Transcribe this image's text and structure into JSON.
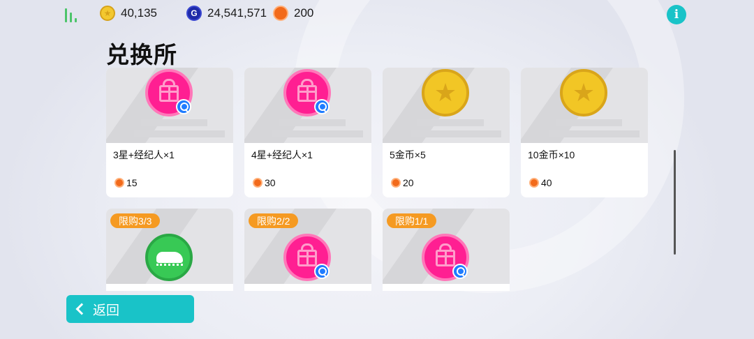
{
  "currencies": {
    "gold": "40,135",
    "gp": "24,541,571",
    "gp_icon_letter": "G",
    "tokens": "200"
  },
  "page_title": "兑换所",
  "items_row1": [
    {
      "name": "3星+经纪人×1",
      "price": "15",
      "icon": "gift-icon"
    },
    {
      "name": "4星+经纪人×1",
      "price": "30",
      "icon": "gift-icon"
    },
    {
      "name": "5金币×5",
      "price": "20",
      "icon": "star-coin-icon"
    },
    {
      "name": "10金币×10",
      "price": "40",
      "icon": "star-coin-icon"
    }
  ],
  "items_row2": [
    {
      "limit": "限购3/3",
      "icon": "boot-icon"
    },
    {
      "limit": "限购2/2",
      "icon": "gift-icon"
    },
    {
      "limit": "限购1/1",
      "icon": "gift-icon"
    }
  ],
  "back_label": "返回",
  "info_label": "i",
  "star_glyph": "★",
  "colors": {
    "accent": "#19c3c8",
    "gift": "#ff1f92",
    "gold": "#f2c625",
    "badge": "#f59a22",
    "token": "#f26a1b"
  }
}
